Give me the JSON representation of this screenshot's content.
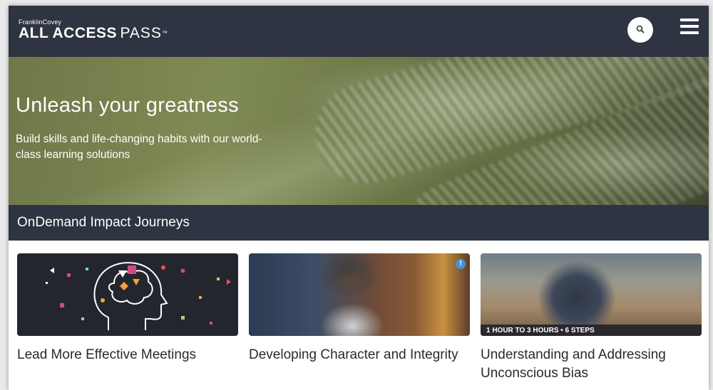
{
  "header": {
    "logo_top": "FranklinCovey",
    "logo_bold": "ALL ACCESS",
    "logo_light": "PASS",
    "logo_tm": "™",
    "search_icon": "search-icon",
    "menu_icon": "hamburger-menu-icon"
  },
  "hero": {
    "title": "Unleash your greatness",
    "subtitle": "Build skills and life-changing habits with our world-class learning solutions"
  },
  "section": {
    "title": "OnDemand Impact Journeys"
  },
  "cards": [
    {
      "title": "Lead More Effective Meetings"
    },
    {
      "title": "Developing Character and Integrity",
      "badge": "!"
    },
    {
      "title": "Understanding and Addressing Unconscious Bias",
      "band": "1 HOUR TO 3 HOURS • 6 STEPS"
    }
  ],
  "colors": {
    "header_bg": "#2f3442",
    "text_dark": "#2a2a2a"
  }
}
